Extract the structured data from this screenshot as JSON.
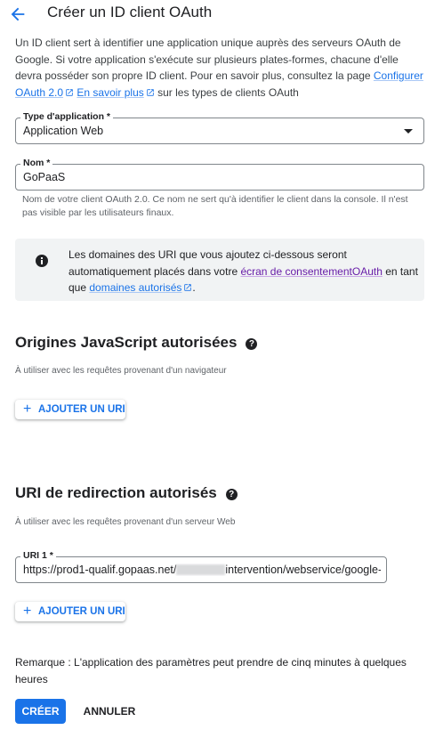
{
  "header": {
    "title": "Créer un ID client OAuth",
    "back_icon": "arrow-back-icon"
  },
  "intro": {
    "text_1": "Un ID client sert à identifier une application unique auprès des serveurs OAuth de Google. Si votre application s'exécute sur plusieurs plates-formes, chacune d'elle devra posséder son propre ID client. Pour en savoir plus, consultez la page ",
    "link_configure": "Configurer OAuth 2.0",
    "link_learn_more": "En savoir plus",
    "text_2": " sur les types de clients OAuth"
  },
  "app_type": {
    "label": "Type d'application *",
    "value": "Application Web"
  },
  "name_field": {
    "label": "Nom *",
    "value": "GoPaaS",
    "helper": "Nom de votre client OAuth 2.0. Ce nom ne sert qu'à identifier le client dans la console. Il n'est pas visible par les utilisateurs finaux."
  },
  "info_box": {
    "text_1": "Les domaines des URI que vous ajoutez ci-dessous seront automatiquement placés dans votre ",
    "link_consent": "écran de consentementOAuth",
    "text_2": " en tant que ",
    "link_domains": "domaines autorisés",
    "text_3": "."
  },
  "js_origins": {
    "title": "Origines JavaScript autorisées",
    "description": "À utiliser avec les requêtes provenant d'un navigateur",
    "add_button": "AJOUTER UN URI"
  },
  "redirect_uris": {
    "title": "URI de redirection autorisés",
    "description": "À utiliser avec les requêtes provenant d'un serveur Web",
    "uri_label": "URI 1 *",
    "uri_value_start": "https://prod1-qualif.gopaas.net/",
    "uri_value_end": "intervention/webservice/google-sy",
    "add_button": "AJOUTER UN URI"
  },
  "note": "Remarque : L'application des paramètres peut prendre de cinq minutes à quelques heures",
  "actions": {
    "create": "CRÉER",
    "cancel": "ANNULER"
  },
  "colors": {
    "accent": "#1a73e8",
    "visited_link": "#681da8",
    "info_bg": "#f1f3f4"
  }
}
